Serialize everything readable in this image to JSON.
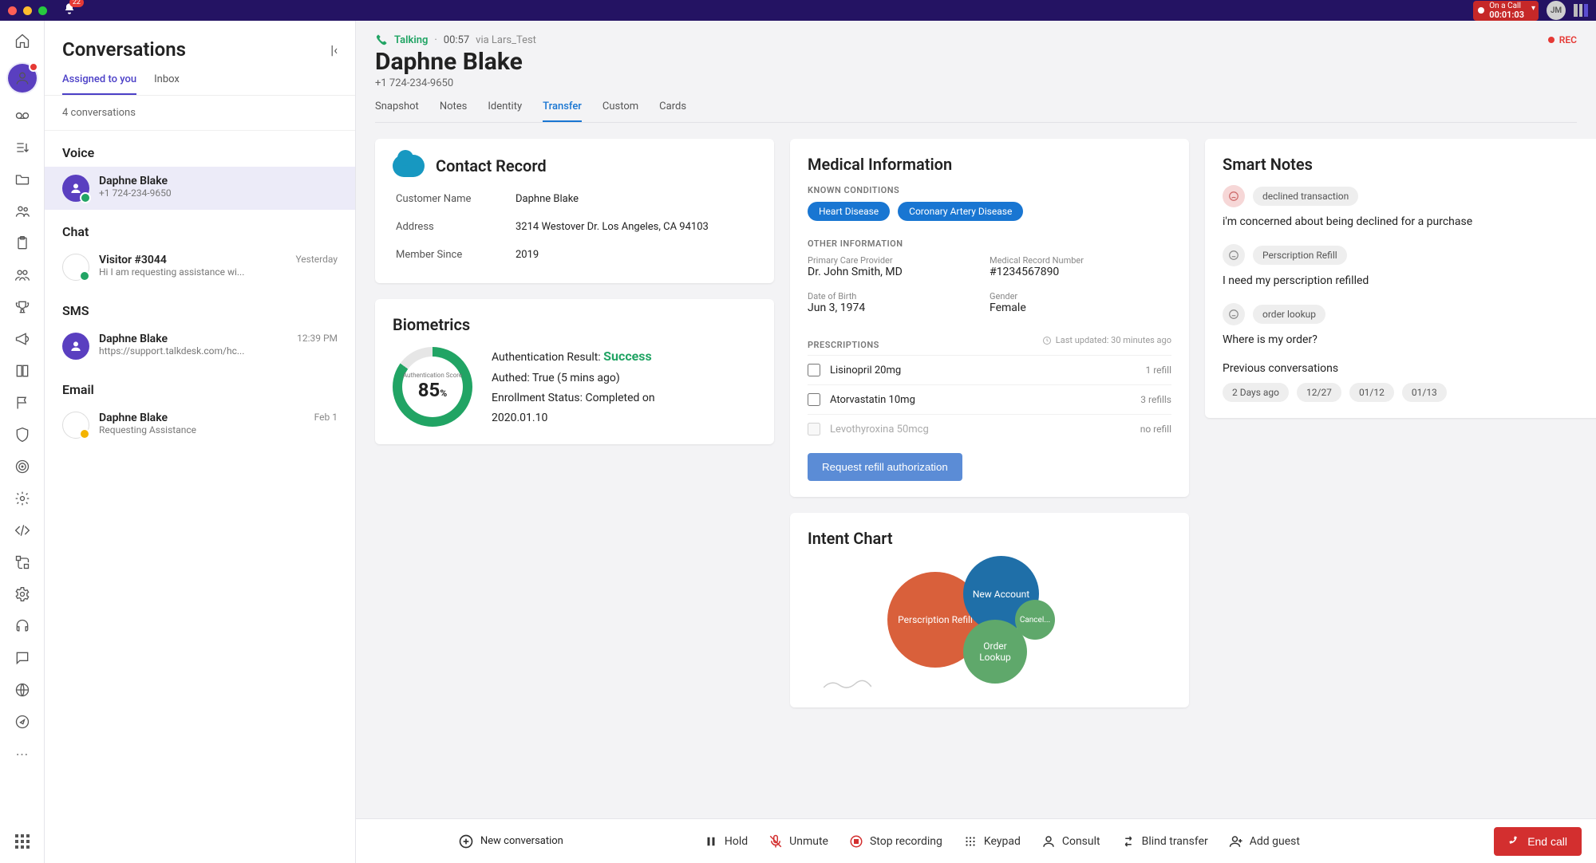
{
  "titlebar": {
    "bell_badge": "22",
    "call_status_label": "On a Call",
    "call_timer": "00:01:03",
    "user_initials": "JM"
  },
  "conversations": {
    "title": "Conversations",
    "tabs": {
      "assigned": "Assigned to you",
      "inbox": "Inbox"
    },
    "count": "4 conversations",
    "voice_label": "Voice",
    "chat_label": "Chat",
    "sms_label": "SMS",
    "email_label": "Email",
    "voice_item": {
      "name": "Daphne Blake",
      "sub": "+1 724-234-9650"
    },
    "chat_item": {
      "name": "Visitor #3044",
      "sub": "Hi I am requesting assistance wi...",
      "time": "Yesterday"
    },
    "sms_item": {
      "name": "Daphne Blake",
      "sub": "https://support.talkdesk.com/hc...",
      "time": "12:39 PM"
    },
    "email_item": {
      "name": "Daphne Blake",
      "sub": "Requesting Assistance",
      "time": "Feb 1"
    }
  },
  "header": {
    "status": "Talking",
    "duration": "00:57",
    "via_label": "via Lars_Test",
    "contact_name": "Daphne Blake",
    "phone": "+1 724-234-9650",
    "rec": "REC",
    "tabs": {
      "snapshot": "Snapshot",
      "notes": "Notes",
      "identity": "Identity",
      "transfer": "Transfer",
      "custom": "Custom",
      "cards": "Cards"
    }
  },
  "contact_record": {
    "title": "Contact Record",
    "customer_name_k": "Customer Name",
    "customer_name_v": "Daphne Blake",
    "address_k": "Address",
    "address_v": "3214 Westover Dr. Los Angeles, CA 94103",
    "member_since_k": "Member Since",
    "member_since_v": "2019"
  },
  "biometrics": {
    "title": "Biometrics",
    "score_label": "Authentication Score",
    "score": "85",
    "score_unit": "%",
    "auth_result_label": "Authentication Result: ",
    "auth_result": "Success",
    "authed": "Authed: True (5 mins ago)",
    "enrollment": "Enrollment Status: Completed on 2020.01.10"
  },
  "medical": {
    "title": "Medical Information",
    "known_label": "KNOWN CONDITIONS",
    "cond1": "Heart Disease",
    "cond2": "Coronary Artery Disease",
    "other_label": "OTHER INFORMATION",
    "pcp_k": "Primary Care Provider",
    "pcp_v": "Dr. John Smith, MD",
    "mrn_k": "Medical Record Number",
    "mrn_v": "#1234567890",
    "dob_k": "Date of Birth",
    "dob_v": "Jun 3, 1974",
    "gender_k": "Gender",
    "gender_v": "Female",
    "presc_label": "PRESCRIPTIONS",
    "updated": "Last updated: 30 minutes ago",
    "p1": "Lisinopril 20mg",
    "p1r": "1 refill",
    "p2": "Atorvastatin 10mg",
    "p2r": "3 refills",
    "p3": "Levothyroxina 50mcg",
    "p3r": "no refill",
    "refill_btn": "Request refill authorization"
  },
  "smart_notes": {
    "title": "Smart Notes",
    "n1_tag": "declined transaction",
    "n1_text": "i'm concerned about being declined for a purchase",
    "n2_tag": "Perscription Refill",
    "n2_text": "I need my perscription refilled",
    "n3_tag": "order lookup",
    "n3_text": "Where is my order?",
    "prev_label": "Previous conversations",
    "c1": "2 Days ago",
    "c2": "12/27",
    "c3": "01/12",
    "c4": "01/13"
  },
  "intent": {
    "title": "Intent Chart",
    "b1": "Perscription Refill",
    "b2": "New Account",
    "b3": "Order Lookup",
    "b4": "Cancel..."
  },
  "footer": {
    "new_conv": "New conversation",
    "hold": "Hold",
    "unmute": "Unmute",
    "stop_rec": "Stop recording",
    "keypad": "Keypad",
    "consult": "Consult",
    "blind": "Blind transfer",
    "add_guest": "Add guest",
    "end": "End call"
  },
  "chart_data": {
    "type": "pie",
    "title": "Intent Chart",
    "series": [
      {
        "name": "Perscription Refill",
        "value": 40,
        "color": "#d9603b"
      },
      {
        "name": "New Account",
        "value": 25,
        "color": "#1f6fa8"
      },
      {
        "name": "Order Lookup",
        "value": 20,
        "color": "#5fa86b"
      },
      {
        "name": "Cancel",
        "value": 15,
        "color": "#5fa86b"
      }
    ]
  }
}
